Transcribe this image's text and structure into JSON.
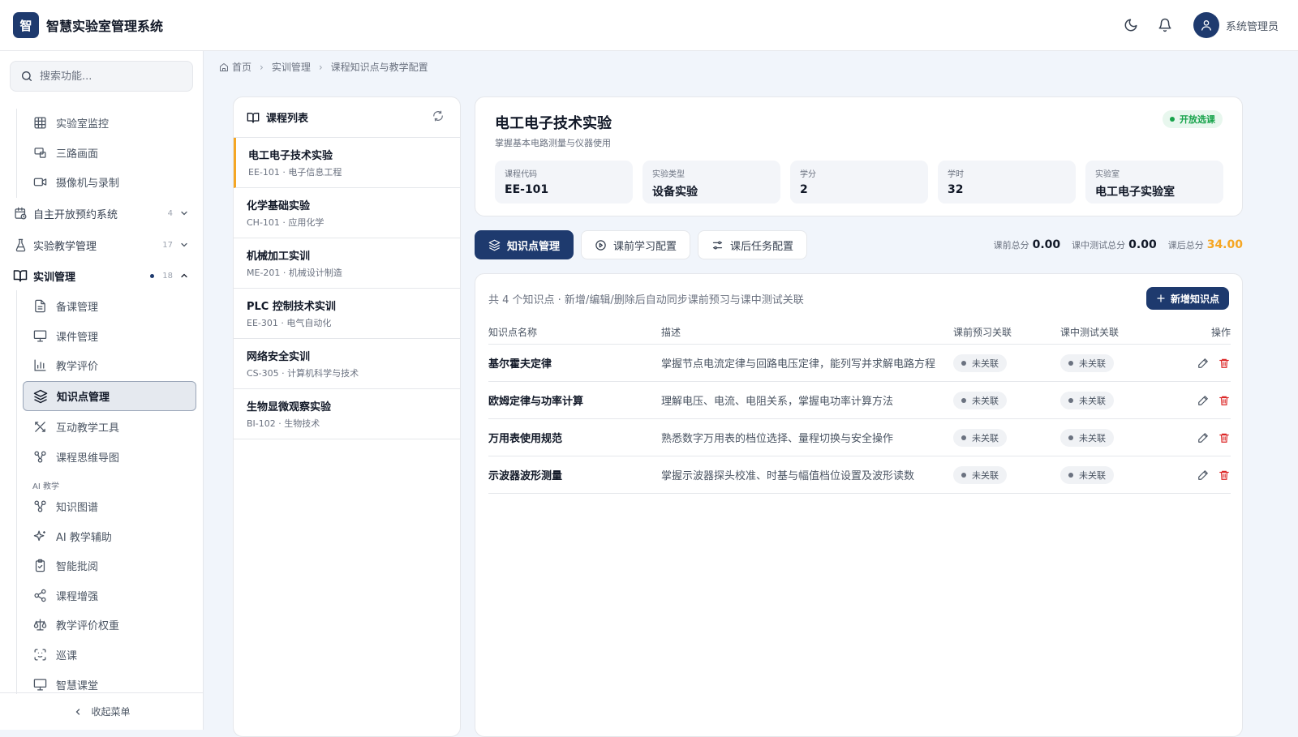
{
  "app": {
    "logo_char": "智",
    "title": "智慧实验室管理系统",
    "username": "系统管理员"
  },
  "search": {
    "placeholder": "搜索功能..."
  },
  "sidebar": {
    "items": [
      {
        "label": "实验室监控"
      },
      {
        "label": "三路画面"
      },
      {
        "label": "摄像机与录制"
      },
      {
        "label": "自主开放预约系统",
        "count": "4"
      },
      {
        "label": "实验教学管理",
        "count": "17"
      },
      {
        "label": "实训管理",
        "count": "18"
      },
      {
        "label": "备课管理"
      },
      {
        "label": "课件管理"
      },
      {
        "label": "教学评价"
      },
      {
        "label": "知识点管理"
      },
      {
        "label": "互动教学工具"
      },
      {
        "label": "课程思维导图"
      },
      {
        "label": "知识图谱"
      },
      {
        "label": "AI 教学辅助"
      },
      {
        "label": "智能批阅"
      },
      {
        "label": "课程增强"
      },
      {
        "label": "教学评价权重"
      },
      {
        "label": "巡课"
      },
      {
        "label": "智慧课堂"
      }
    ],
    "section_ai": "AI 教学",
    "collapse_label": "收起菜单"
  },
  "breadcrumb": {
    "home": "首页",
    "level1": "实训管理",
    "level2": "课程知识点与教学配置"
  },
  "course_list": {
    "title": "课程列表",
    "courses": [
      {
        "name": "电工电子技术实验",
        "sub": "EE-101 · 电子信息工程"
      },
      {
        "name": "化学基础实验",
        "sub": "CH-101 · 应用化学"
      },
      {
        "name": "机械加工实训",
        "sub": "ME-201 · 机械设计制造"
      },
      {
        "name": "PLC 控制技术实训",
        "sub": "EE-301 · 电气自动化"
      },
      {
        "name": "网络安全实训",
        "sub": "CS-305 · 计算机科学与技术"
      },
      {
        "name": "生物显微观察实验",
        "sub": "BI-102 · 生物技术"
      }
    ]
  },
  "course_info": {
    "title": "电工电子技术实验",
    "subtitle": "掌握基本电路测量与仪器使用",
    "status": "开放选课",
    "status_color": "#16a34a",
    "metrics": [
      {
        "label": "课程代码",
        "value": "EE-101"
      },
      {
        "label": "实验类型",
        "value": "设备实验"
      },
      {
        "label": "学分",
        "value": "2"
      },
      {
        "label": "学时",
        "value": "32"
      },
      {
        "label": "实验室",
        "value": "电工电子实验室"
      }
    ]
  },
  "tabs": [
    {
      "label": "知识点管理",
      "icon": "layers-icon"
    },
    {
      "label": "课前学习配置",
      "icon": "play-circle-icon"
    },
    {
      "label": "课后任务配置",
      "icon": "sliders-icon"
    }
  ],
  "totals": {
    "pre_label": "课前总分",
    "pre_value": "0.00",
    "mid_label": "课中测试总分",
    "mid_value": "0.00",
    "post_label": "课后总分",
    "post_value": "34.00",
    "post_color": "#f5a623"
  },
  "knowledge": {
    "summary": "共 4 个知识点 · 新增/编辑/删除后自动同步课前预习与课中测试关联",
    "add_label": "新增知识点",
    "headers": {
      "name": "知识点名称",
      "desc": "描述",
      "pre": "课前预习关联",
      "mid": "课中测试关联",
      "ops": "操作"
    },
    "rows": [
      {
        "name": "基尔霍夫定律",
        "desc": "掌握节点电流定律与回路电压定律，能列写并求解电路方程",
        "pre": "未关联",
        "mid": "未关联"
      },
      {
        "name": "欧姆定律与功率计算",
        "desc": "理解电压、电流、电阻关系，掌握电功率计算方法",
        "pre": "未关联",
        "mid": "未关联"
      },
      {
        "name": "万用表使用规范",
        "desc": "熟悉数字万用表的档位选择、量程切换与安全操作",
        "pre": "未关联",
        "mid": "未关联"
      },
      {
        "name": "示波器波形测量",
        "desc": "掌握示波器探头校准、时基与幅值档位设置及波形读数",
        "pre": "未关联",
        "mid": "未关联"
      }
    ]
  },
  "colors": {
    "primary": "#1e3a6e",
    "accent": "#f5a623",
    "danger": "#dc2626"
  }
}
